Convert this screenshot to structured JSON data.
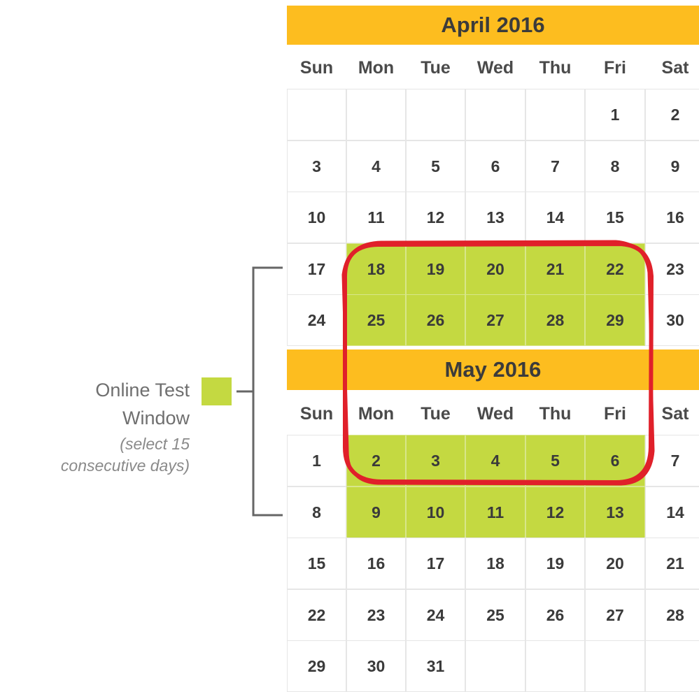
{
  "legend": {
    "title_line1": "Online Test",
    "title_line2": "Window",
    "note_line1": "(select 15",
    "note_line2": "consecutive days)",
    "swatch_color": "#C4D941"
  },
  "colors": {
    "header": "#FDBD1F",
    "highlight": "#C4D941",
    "selection_outline": "#E0202A",
    "bracket": "#666666"
  },
  "weekdays": [
    "Sun",
    "Mon",
    "Tue",
    "Wed",
    "Thu",
    "Fri",
    "Sat"
  ],
  "months": [
    {
      "title": "April 2016",
      "weeks": [
        [
          "",
          "",
          "",
          "",
          "",
          "1",
          "2"
        ],
        [
          "3",
          "4",
          "5",
          "6",
          "7",
          "8",
          "9"
        ],
        [
          "10",
          "11",
          "12",
          "13",
          "14",
          "15",
          "16"
        ],
        [
          "17",
          "18",
          "19",
          "20",
          "21",
          "22",
          "23"
        ],
        [
          "24",
          "25",
          "26",
          "27",
          "28",
          "29",
          "30"
        ]
      ],
      "highlighted": [
        "18",
        "19",
        "20",
        "21",
        "22",
        "25",
        "26",
        "27",
        "28",
        "29"
      ]
    },
    {
      "title": "May 2016",
      "weeks": [
        [
          "1",
          "2",
          "3",
          "4",
          "5",
          "6",
          "7"
        ],
        [
          "8",
          "9",
          "10",
          "11",
          "12",
          "13",
          "14"
        ],
        [
          "15",
          "16",
          "17",
          "18",
          "19",
          "20",
          "21"
        ],
        [
          "22",
          "23",
          "24",
          "25",
          "26",
          "27",
          "28"
        ],
        [
          "29",
          "30",
          "31",
          "",
          "",
          "",
          ""
        ]
      ],
      "highlighted": [
        "2",
        "3",
        "4",
        "5",
        "6",
        "9",
        "10",
        "11",
        "12",
        "13"
      ]
    }
  ]
}
